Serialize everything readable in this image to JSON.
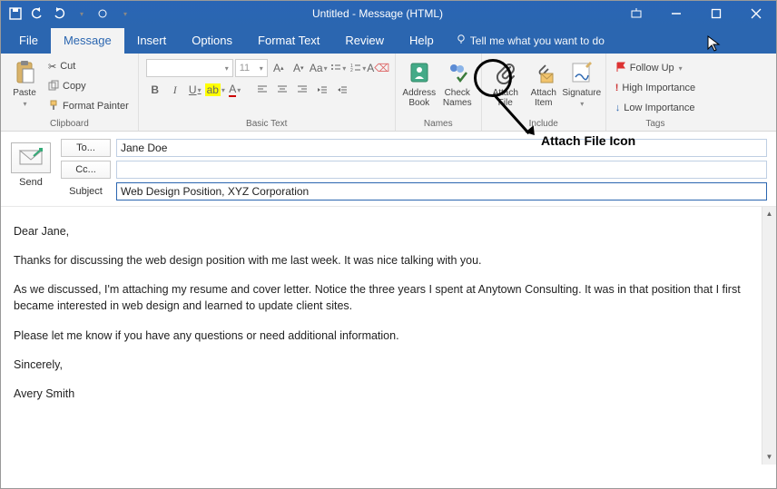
{
  "window": {
    "title": "Untitled - Message (HTML)"
  },
  "tabs": {
    "file": "File",
    "message": "Message",
    "insert": "Insert",
    "options": "Options",
    "format": "Format Text",
    "review": "Review",
    "help": "Help",
    "tellme": "Tell me what you want to do"
  },
  "ribbon": {
    "clipboard": {
      "label": "Clipboard",
      "paste": "Paste",
      "cut": "Cut",
      "copy": "Copy",
      "painter": "Format Painter"
    },
    "basic_text": {
      "label": "Basic Text",
      "font_size": "11"
    },
    "names": {
      "label": "Names",
      "address": "Address\nBook",
      "check": "Check\nNames"
    },
    "include": {
      "label": "Include",
      "attach_file": "Attach\nFile",
      "attach_item": "Attach\nItem",
      "signature": "Signature"
    },
    "tags": {
      "label": "Tags",
      "follow": "Follow Up",
      "high": "High Importance",
      "low": "Low Importance"
    }
  },
  "compose": {
    "send": "Send",
    "to_btn": "To...",
    "cc_btn": "Cc...",
    "subject_lbl": "Subject",
    "to_val": "Jane Doe",
    "cc_val": "",
    "subject_val": "Web Design Position, XYZ Corporation"
  },
  "body": {
    "greet": "Dear Jane,",
    "p1": "Thanks for discussing the web design position with me last week. It was nice talking with you.",
    "p2": "As we discussed, I'm attaching my resume and cover letter. Notice the three years I spent at Anytown Consulting. It was in that position that I first became interested in web design and learned to update client sites.",
    "p3": "Please let me know if you have any questions or need additional information.",
    "close": "Sincerely,",
    "sig": "Avery Smith"
  },
  "annotation": {
    "text": "Attach File Icon"
  }
}
